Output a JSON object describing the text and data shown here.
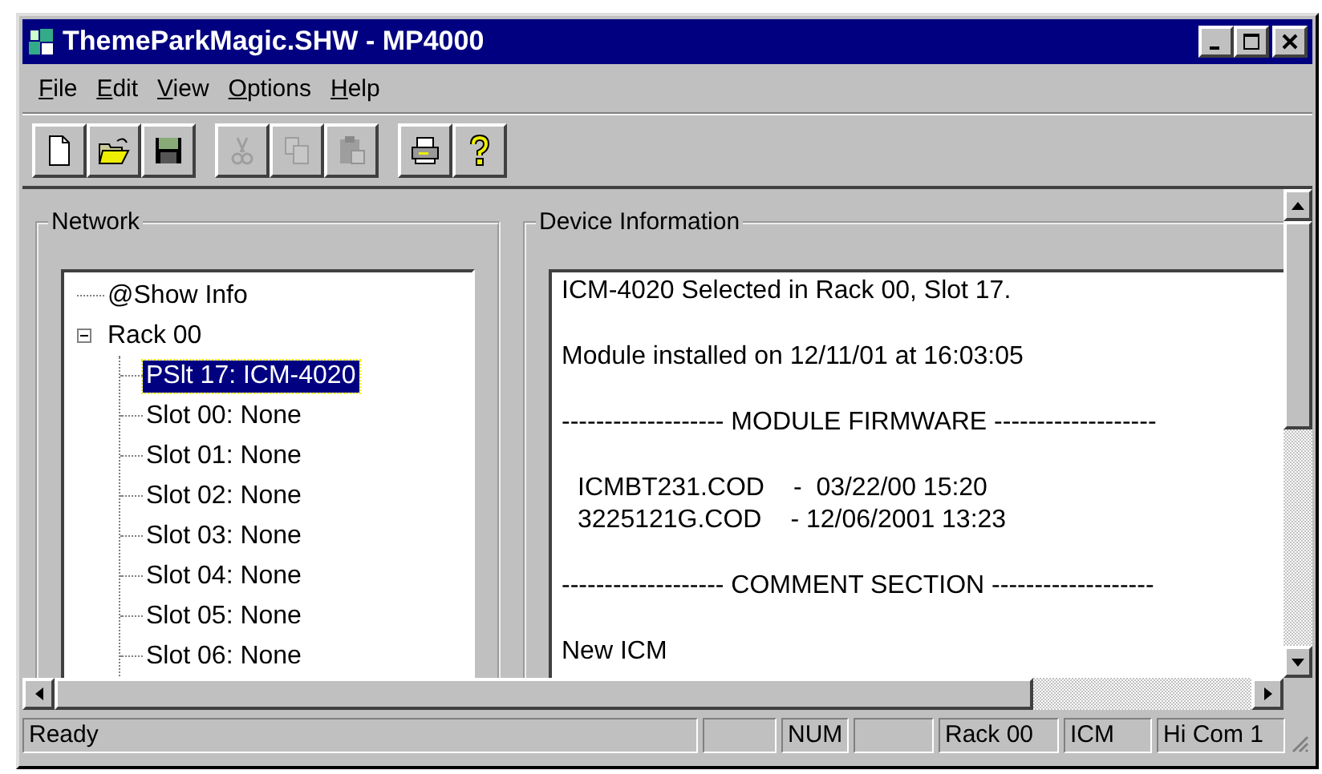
{
  "window": {
    "title": "ThemeParkMagic.SHW - MP4000"
  },
  "menu": [
    {
      "label": "File"
    },
    {
      "label": "Edit"
    },
    {
      "label": "View"
    },
    {
      "label": "Options"
    },
    {
      "label": "Help"
    }
  ],
  "toolbar": [
    {
      "kind": "new",
      "disabled": false
    },
    {
      "kind": "open",
      "disabled": false
    },
    {
      "kind": "save",
      "disabled": false
    },
    {
      "kind": "sep"
    },
    {
      "kind": "cut",
      "disabled": true
    },
    {
      "kind": "copy",
      "disabled": true
    },
    {
      "kind": "paste",
      "disabled": true
    },
    {
      "kind": "sep"
    },
    {
      "kind": "print",
      "disabled": false
    },
    {
      "kind": "help",
      "disabled": false
    }
  ],
  "network": {
    "title": "Network",
    "tree": [
      {
        "label": "@Show Info",
        "selected": false
      },
      {
        "label": "Rack 00",
        "selected": false,
        "expanded": true,
        "children": [
          {
            "label": "PSlt 17: ICM-4020",
            "selected": true
          },
          {
            "label": "Slot 00: None",
            "selected": false
          },
          {
            "label": "Slot 01: None",
            "selected": false
          },
          {
            "label": "Slot 02: None",
            "selected": false
          },
          {
            "label": "Slot 03: None",
            "selected": false
          },
          {
            "label": "Slot 04: None",
            "selected": false
          },
          {
            "label": "Slot 05: None",
            "selected": false
          },
          {
            "label": "Slot 06: None",
            "selected": false
          }
        ]
      }
    ]
  },
  "device_information": {
    "title": "Device Information",
    "lines": [
      {
        "kind": "para",
        "text": "ICM-4020 Selected in Rack 00, Slot 17."
      },
      {
        "kind": "para",
        "text": "Module installed on 12/11/01 at 16:03:05"
      },
      {
        "kind": "para",
        "text": "------------------- MODULE FIRMWARE -------------------"
      },
      {
        "kind": "firmware",
        "file": "ICMBT231.COD",
        "date": "-  03/22/00 15:20"
      },
      {
        "kind": "firmware",
        "file": "3225121G.COD",
        "date": "- 12/06/2001 13:23"
      },
      {
        "kind": "para",
        "text": "------------------- COMMENT SECTION -------------------"
      },
      {
        "kind": "para",
        "text": "New ICM"
      }
    ]
  },
  "status_bar": [
    {
      "kind": "text",
      "text": "Ready"
    },
    {
      "kind": "blank"
    },
    {
      "kind": "text",
      "text": "NUM"
    },
    {
      "kind": "blank"
    },
    {
      "kind": "text",
      "text": "Rack 00"
    },
    {
      "kind": "text",
      "text": "ICM"
    },
    {
      "kind": "text",
      "text": "Hi Com 1"
    }
  ]
}
